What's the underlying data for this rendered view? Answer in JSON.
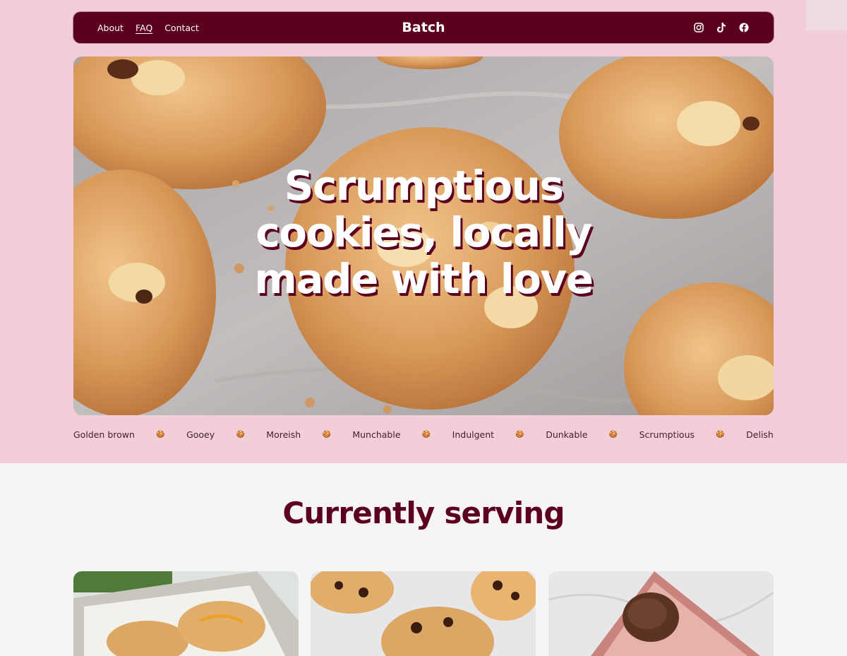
{
  "nav": {
    "links": [
      "About",
      "FAQ",
      "Contact"
    ],
    "brand": "Batch",
    "social": [
      "instagram-icon",
      "tiktok-icon",
      "facebook-icon"
    ]
  },
  "hero": {
    "title_lines": [
      "Scrumptious",
      "cookies, locally",
      "made with love"
    ]
  },
  "ticker": {
    "words": [
      "Golden brown",
      "Gooey",
      "Moreish",
      "Munchable",
      "Indulgent",
      "Dunkable",
      "Scrumptious",
      "Delish"
    ],
    "separator": "🍪"
  },
  "serving": {
    "title": "Currently serving"
  },
  "colors": {
    "accent": "#5c0020",
    "top_background": "#f2ced9",
    "page_background": "#f6f4f7"
  }
}
